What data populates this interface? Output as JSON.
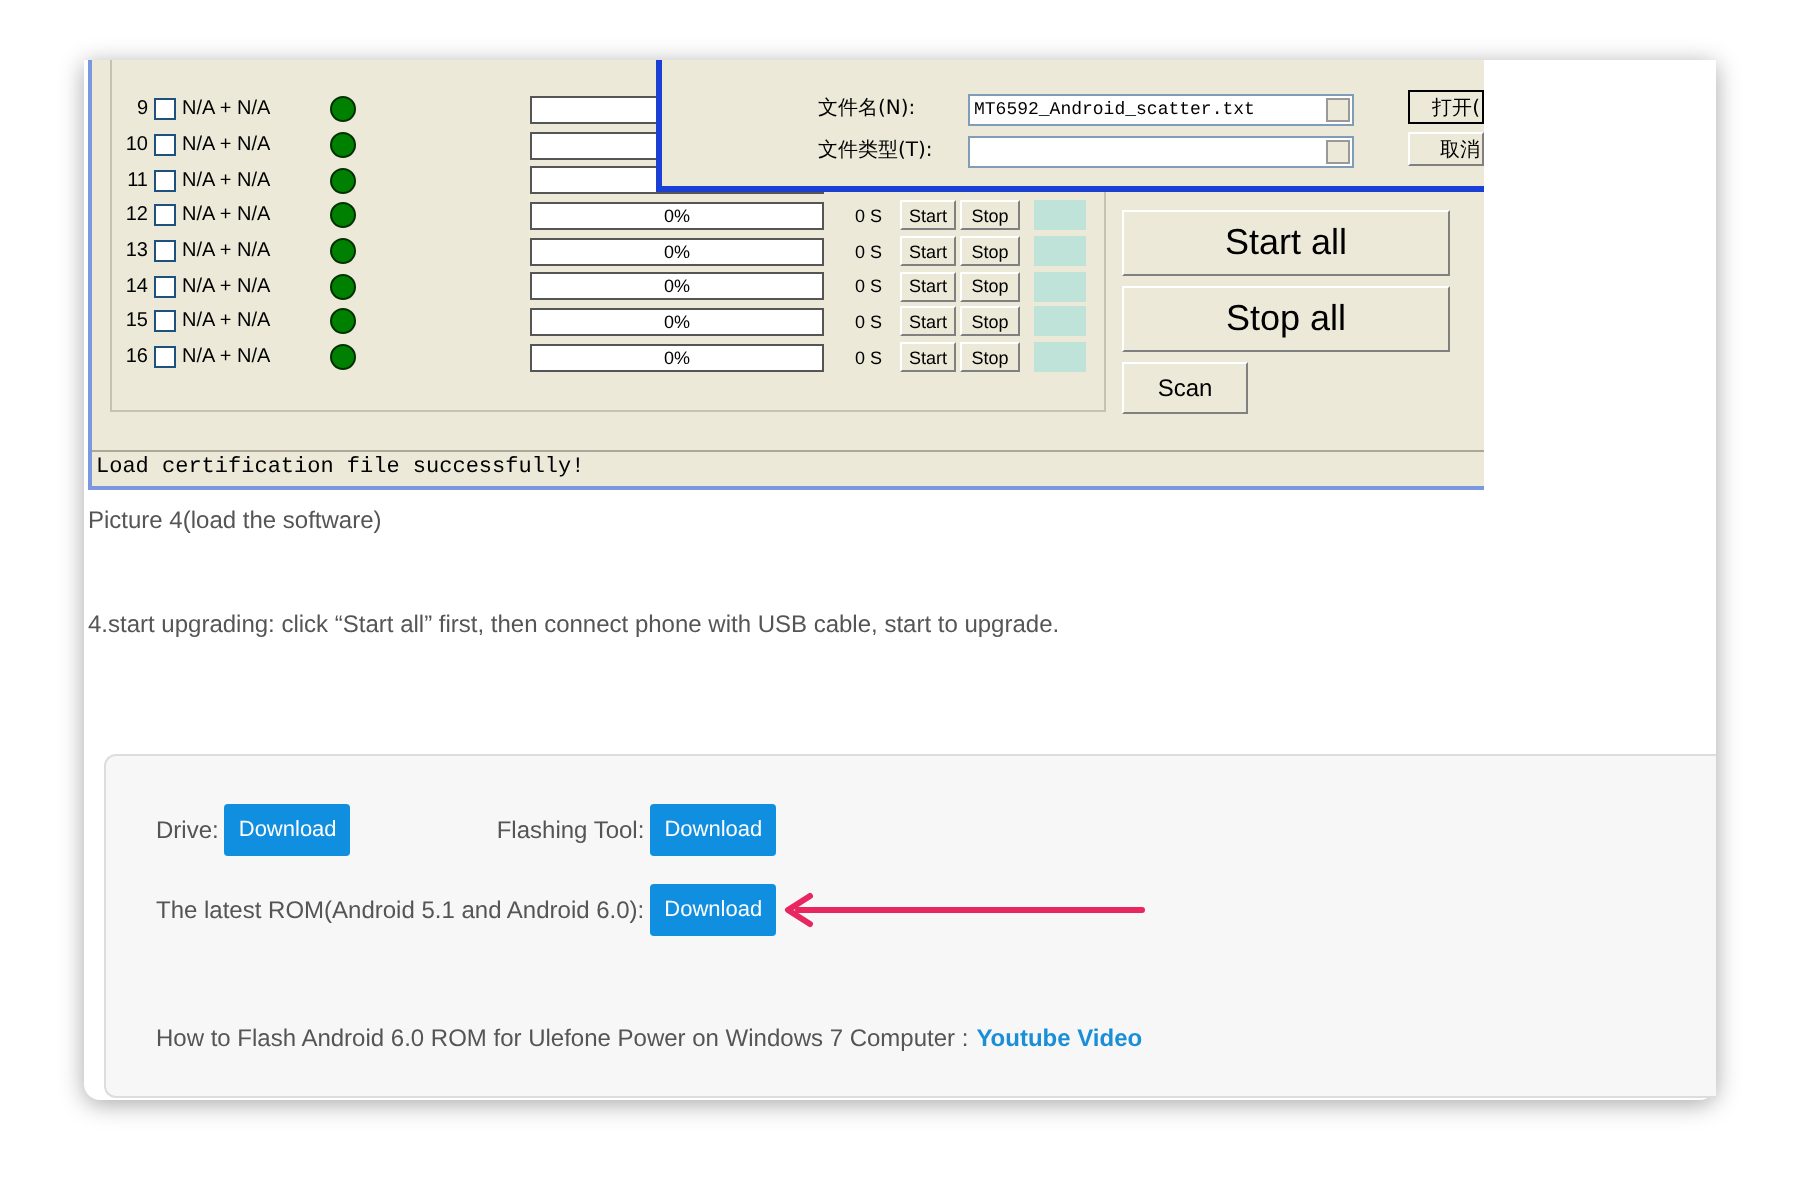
{
  "tool_window": {
    "rows": [
      {
        "kind": "covered",
        "number": "9",
        "checked": false,
        "label": "N/A + N/A",
        "level": 0
      },
      {
        "kind": "covered",
        "number": "10",
        "checked": false,
        "label": "N/A + N/A",
        "level": 0
      },
      {
        "kind": "covered",
        "number": "11",
        "checked": false,
        "label": "N/A + N/A",
        "level": 0
      },
      {
        "kind": "full",
        "number": "12",
        "checked": false,
        "label": "N/A + N/A",
        "level": 0,
        "progress": "0%",
        "time": "0 S",
        "start_button": "Start",
        "stop_button": "Stop"
      },
      {
        "kind": "full",
        "number": "13",
        "checked": false,
        "label": "N/A + N/A",
        "level": 0,
        "progress": "0%",
        "time": "0 S",
        "start_button": "Start",
        "stop_button": "Stop"
      },
      {
        "kind": "full",
        "number": "14",
        "checked": false,
        "label": "N/A + N/A",
        "level": 0,
        "progress": "0%",
        "time": "0 S",
        "start_button": "Start",
        "stop_button": "Stop"
      },
      {
        "kind": "full",
        "number": "15",
        "checked": false,
        "label": "N/A + N/A",
        "level": 0,
        "progress": "0%",
        "time": "0 S",
        "start_button": "Start",
        "stop_button": "Stop"
      },
      {
        "kind": "full",
        "number": "16",
        "checked": false,
        "label": "N/A + N/A",
        "level": 0,
        "progress": "0%",
        "time": "0 S",
        "start_button": "Start",
        "stop_button": "Stop"
      }
    ],
    "start_all": "Start all",
    "stop_all": "Stop all",
    "scan": "Scan",
    "status_bar": "Load certification file successfully!",
    "file_dialog": {
      "file_name_label": "文件名(N):",
      "file_name": "MT6592_Android_scatter.txt",
      "file_type_label": "文件类型(T):",
      "open_button": "打开(",
      "cancel_button": "取消"
    }
  },
  "caption": "Picture 4(load the software)",
  "instruction": "4.start upgrading: click “Start all” first, then connect phone with USB cable, start to upgrade.",
  "downloads": {
    "drive_label": "Drive:",
    "drive_button": "Download",
    "tool_label": "Flashing Tool:",
    "tool_button": "Download",
    "rom_label": "The latest ROM(Android 5.1 and Android 6.0):",
    "rom_button": "Download",
    "video_text": "How to Flash Android 6.0 ROM for Ulefone Power on Windows 7 Computer :",
    "video_link": "Youtube Video"
  }
}
